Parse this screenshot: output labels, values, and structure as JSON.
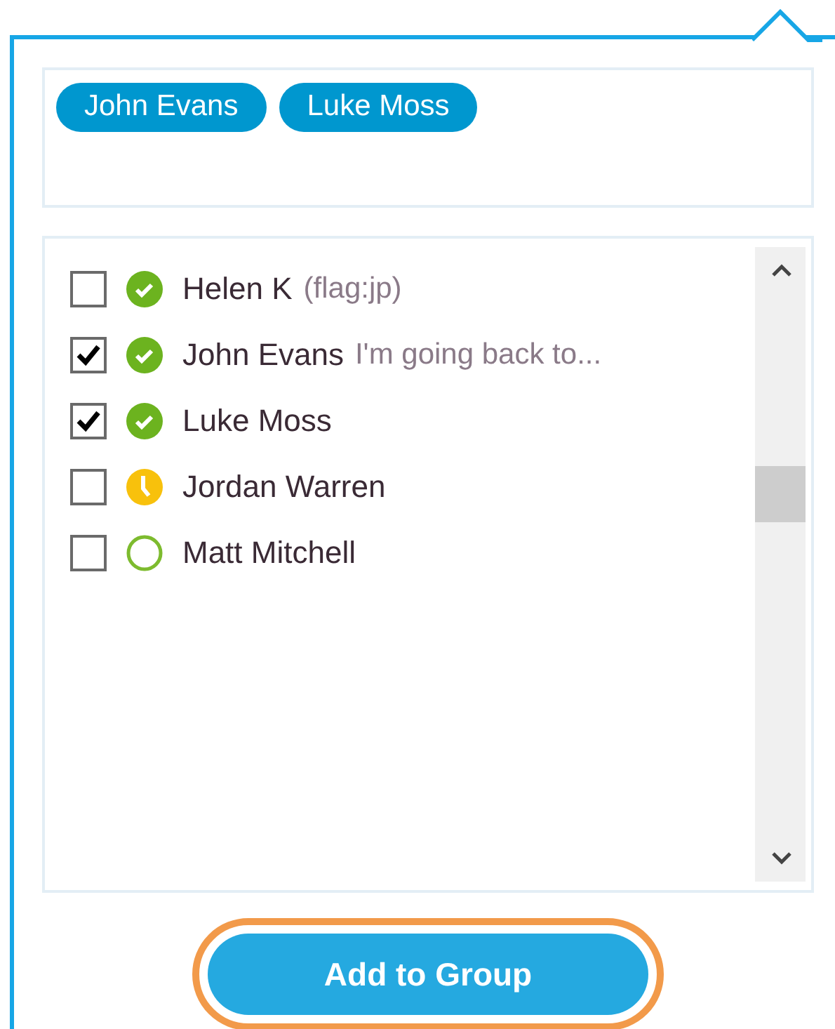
{
  "recipients": [
    {
      "name": "John Evans"
    },
    {
      "name": "Luke Moss"
    }
  ],
  "contacts": [
    {
      "name": "Helen K",
      "note": "(flag:jp)",
      "checked": false,
      "kind": "available"
    },
    {
      "name": "John Evans",
      "note": "I'm going back to...",
      "checked": true,
      "kind": "available"
    },
    {
      "name": "Luke Moss",
      "checked": true,
      "kind": "available"
    },
    {
      "name": "Jordan Warren",
      "checked": false,
      "kind": "away"
    },
    {
      "name": "Matt Mitchell",
      "checked": false,
      "kind": "offline"
    }
  ],
  "add_button": {
    "label": "Add to Group",
    "highlighted": true
  }
}
